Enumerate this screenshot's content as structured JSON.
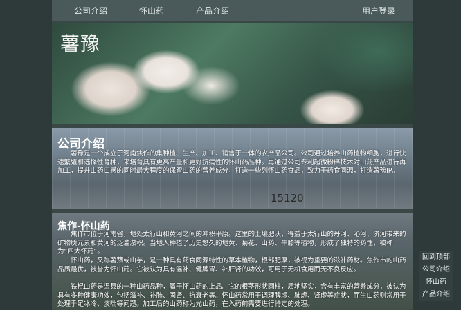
{
  "nav": {
    "items": [
      "公司介绍",
      "怀山药",
      "产品介绍"
    ],
    "login": "用户登录"
  },
  "hero": {
    "title": "薯豫"
  },
  "company": {
    "title": "公司介绍",
    "text": "薯豫是一个成立于河南焦作的集种植、生产、加工、销售于一体的农产品公司。公司通过培养山药植物细胞，进行快速繁殖和选择性育种，来培育具有更高产量和更好抗病性的怀山药品种。再通过公司专利超微粉碎技术对山药产品进行再加工，提升山药口感的同时最大程度的保留山药的营养成分，打造一些列怀山药食品，致力于药食同源，打造薯豫IP。",
    "sign": "15120"
  },
  "jiaozuo": {
    "title": "焦作-怀山药",
    "p1": "焦作市位于河南省，地处太行山和黄河之间的冲积平原。这里的土壤肥沃，得益于太行山的丹河、沁河、济河带来的矿物质元素和黄河的泛滥淤积。当地人种植了历史悠久的地黄、菊花、山药、牛膝等植物，形成了独特的药性，被称为“四大怀药”。",
    "p2": "怀山药，又称薯蓣或山芋，是一种具有药食同源特性的草本植物，根部肥厚，被视为重要的滋补药材。焦作市的山药品质最优，被誉为怀山药。它被认为具有温补、健脾胃、补肝肾的功效，可用于无机食用而无不良反应。",
    "p3": "铁棍山药是温县的一种山药品种，属于怀山药的上品。它的根茎形状圆柱，质地坚实，含有丰富的营养成分，被认为具有多种健康功效，包括滋补、补肺、固肾、抗衰老等。怀山药常用于调理脾虚、肺虚、肾虚等症状，而生山药则常用于处理手足冰冷、痰喘等问题。加工后的山药称为光山药，在入药前需要进行特定的处理。"
  },
  "sidenav": [
    "回到顶部",
    "公司介绍",
    "怀山药",
    "产品介绍"
  ]
}
